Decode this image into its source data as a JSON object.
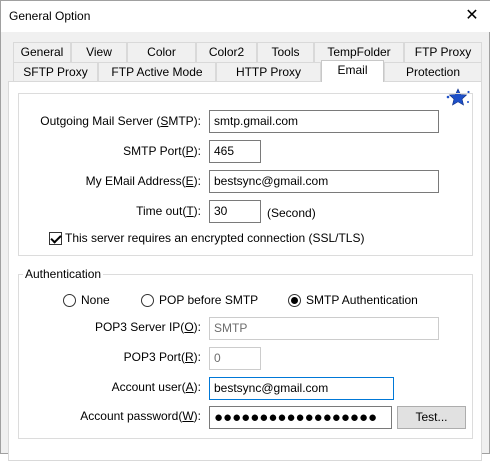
{
  "window": {
    "title": "General Option"
  },
  "tabs_row1": [
    "General",
    "View",
    "Color",
    "Color2",
    "Tools",
    "TempFolder",
    "FTP Proxy"
  ],
  "tabs_row2": [
    "SFTP Proxy",
    "FTP Active Mode",
    "HTTP Proxy",
    "Email",
    "Protection"
  ],
  "active_tab": "Email",
  "server": {
    "smtp_label_pre": "Outgoing Mail Server (",
    "smtp_label_key": "S",
    "smtp_label_post": "MTP):",
    "smtp_value": "smtp.gmail.com",
    "port_label_pre": "SMTP Port(",
    "port_label_key": "P",
    "port_label_post": "):",
    "port_value": "465",
    "email_label_pre": "My EMail Address(",
    "email_label_key": "E",
    "email_label_post": "):",
    "email_value": "bestsync@gmail.com",
    "timeout_label_pre": "Time out(",
    "timeout_label_key": "T",
    "timeout_label_post": "):",
    "timeout_value": "30",
    "timeout_unit": "(Second)",
    "ssl_label": "This server requires an encrypted connection (SSL/TLS)",
    "ssl_checked": true
  },
  "auth": {
    "legend": "Authentication",
    "radio_none": "None",
    "radio_pop": "POP before SMTP",
    "radio_smtp": "SMTP Authentication",
    "selected": "SMTP Authentication",
    "pop3_server_label_pre": "POP3 Server IP(",
    "pop3_server_label_key": "O",
    "pop3_server_label_post": "):",
    "pop3_server_placeholder": "SMTP",
    "pop3_port_label_pre": "POP3 Port(",
    "pop3_port_label_key": "R",
    "pop3_port_label_post": "):",
    "pop3_port_value": "0",
    "user_label_pre": "Account user(",
    "user_label_key": "A",
    "user_label_post": "):",
    "user_value": "bestsync@gmail.com",
    "password_label_pre": "Account password(",
    "password_label_key": "W",
    "password_label_post": "):",
    "password_masked": "●●●●●●●●●●●●●●●●●●",
    "test_button": "Test..."
  },
  "colors": {
    "focus": "#0078d7",
    "panel": "#ffffff",
    "chrome": "#f0f0f0",
    "star": "#1e50c8"
  },
  "icons": {
    "corner": "star-wizard-icon",
    "close": "close-icon"
  }
}
